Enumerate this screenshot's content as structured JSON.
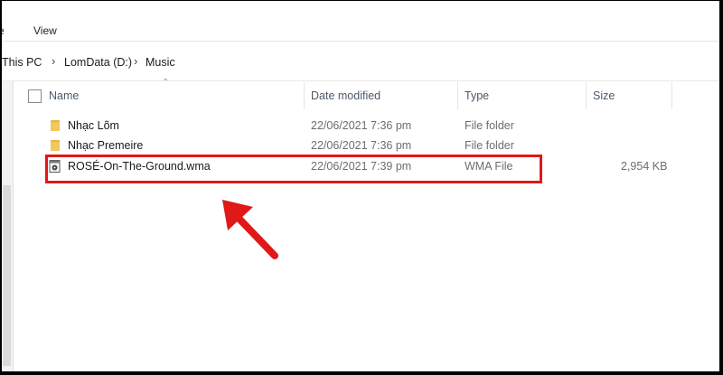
{
  "ribbon": {
    "tabs": [
      "e",
      "View"
    ]
  },
  "address": {
    "path": [
      "This PC",
      "LomData (D:)",
      "Music"
    ]
  },
  "columns": {
    "name": "Name",
    "date": "Date modified",
    "type": "Type",
    "size": "Size"
  },
  "files": [
    {
      "name": "Nhạc Lõm",
      "date": "22/06/2021 7:36 pm",
      "type": "File folder",
      "size": "",
      "icon": "folder-icon"
    },
    {
      "name": "Nhạc Premeire",
      "date": "22/06/2021 7:36 pm",
      "type": "File folder",
      "size": "",
      "icon": "folder-icon"
    },
    {
      "name": "ROSÉ-On-The-Ground.wma",
      "date": "22/06/2021 7:39 pm",
      "type": "WMA File",
      "size": "2,954 KB",
      "icon": "audio-file-icon"
    }
  ],
  "colors": {
    "folder": "#e8b440",
    "highlight": "#e01818",
    "arrow": "#e01818"
  }
}
